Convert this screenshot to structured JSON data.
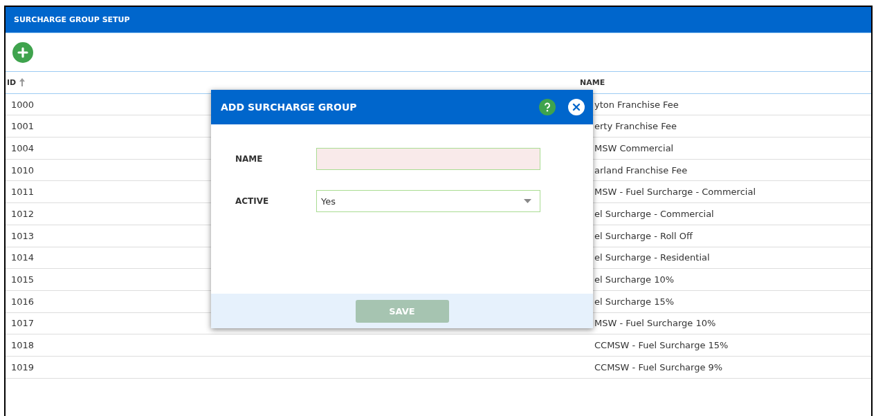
{
  "page": {
    "title": "SURCHARGE GROUP SETUP"
  },
  "table": {
    "columns": [
      {
        "label": "ID",
        "sorted": true
      },
      {
        "label": "NAME",
        "sorted": false
      }
    ],
    "rows": [
      {
        "id": "1000",
        "name": "yton Franchise Fee"
      },
      {
        "id": "1001",
        "name": "erty Franchise Fee"
      },
      {
        "id": "1004",
        "name": "MSW Commercial"
      },
      {
        "id": "1010",
        "name": "arland Franchise Fee"
      },
      {
        "id": "1011",
        "name": "MSW - Fuel Surcharge - Commercial"
      },
      {
        "id": "1012",
        "name": "el Surcharge - Commercial"
      },
      {
        "id": "1013",
        "name": "el Surcharge - Roll Off"
      },
      {
        "id": "1014",
        "name": "el Surcharge - Residential"
      },
      {
        "id": "1015",
        "name": "el Surcharge 10%"
      },
      {
        "id": "1016",
        "name": "el Surcharge 15%"
      },
      {
        "id": "1017",
        "name": "MSW - Fuel Surcharge 10%"
      },
      {
        "id": "1018",
        "name": "CCMSW - Fuel Surcharge 15%"
      },
      {
        "id": "1019",
        "name": "CCMSW - Fuel Surcharge 9%"
      }
    ]
  },
  "dialog": {
    "title": "ADD SURCHARGE GROUP",
    "fields": [
      {
        "kind": "text",
        "label": "NAME",
        "invalid": true
      },
      {
        "kind": "select",
        "label": "ACTIVE",
        "value": "Yes",
        "invalid": false
      }
    ],
    "save_button": {
      "label": "SAVE",
      "disabled": true
    }
  }
}
